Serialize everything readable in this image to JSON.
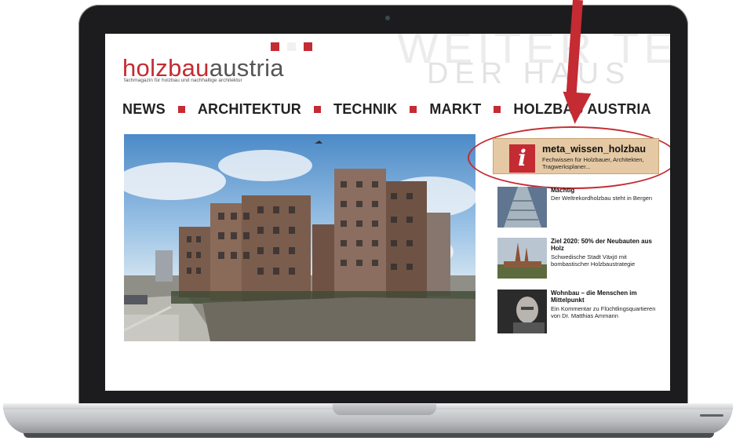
{
  "site": {
    "logo_part1": "holzbau",
    "logo_part2": "austria",
    "tagline": "fachmagazin für holzbau und nachhaltige architektur",
    "ghost_line1": "WEITER TEXT AUS",
    "ghost_line2": "DER HAUS"
  },
  "nav": {
    "items": [
      {
        "label": "NEWS"
      },
      {
        "label": "ARCHITEKTUR"
      },
      {
        "label": "TECHNIK"
      },
      {
        "label": "MARKT"
      },
      {
        "label": "HOLZBAU AUSTRIA"
      }
    ]
  },
  "meta_box": {
    "icon_letter": "i",
    "title": "meta_wissen_holzbau",
    "subtitle": "Fechwissen für Holzbauer, Architekten, Tragwerksplaner..."
  },
  "news": [
    {
      "title": "Mächtig",
      "desc": "Der Weltrekordholzbau steht in Bergen"
    },
    {
      "title": "Ziel 2020: 50% der Neubauten aus Holz",
      "desc": "Schwedische Stadt Växjö mit bombastischer Holzbaustrategie"
    },
    {
      "title": "Wohnbau – die Menschen im Mittelpunkt",
      "desc": "Ein Kommentar zu Flüchtlingsquartieren von Dr. Matthias Ammann"
    }
  ],
  "colors": {
    "accent": "#c52b32",
    "meta_box": "#e5c9a4"
  }
}
